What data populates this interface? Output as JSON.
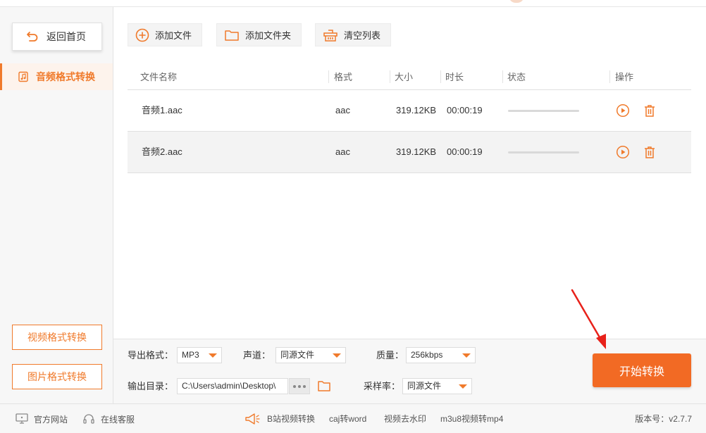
{
  "sidebar": {
    "back_label": "返回首页",
    "active_item": "音频格式转换",
    "video_convert": "视频格式转换",
    "image_convert": "图片格式转换"
  },
  "toolbar": {
    "add_file": "添加文件",
    "add_folder": "添加文件夹",
    "clear_list": "清空列表"
  },
  "table": {
    "columns": [
      "文件名称",
      "格式",
      "大小",
      "时长",
      "状态",
      "操作"
    ],
    "rows": [
      {
        "name": "音频1.aac",
        "format": "aac",
        "size": "319.12KB",
        "duration": "00:00:19",
        "progress": 0
      },
      {
        "name": "音频2.aac",
        "format": "aac",
        "size": "319.12KB",
        "duration": "00:00:19",
        "progress": 0
      }
    ]
  },
  "settings": {
    "export_format_label": "导出格式：",
    "export_format_value": "MP3",
    "channel_label": "声道：",
    "channel_value": "同源文件",
    "quality_label": "质量：",
    "quality_value": "256kbps",
    "output_dir_label": "输出目录：",
    "output_dir_value": "C:\\Users\\admin\\Desktop\\",
    "sample_rate_label": "采样率：",
    "sample_rate_value": "同源文件"
  },
  "start_button": "开始转换",
  "footer": {
    "website": "官方网站",
    "support": "在线客服",
    "links": [
      "B站视频转换",
      "caj转word",
      "视频去水印",
      "m3u8视频转mp4"
    ],
    "version": "版本号：v2.7.7"
  },
  "colors": {
    "accent": "#f07a2b",
    "start_button": "#f26a24"
  },
  "icons": [
    "undo-arrow-icon",
    "music-file-icon",
    "plus-circle-icon",
    "folder-icon",
    "basket-icon",
    "play-icon",
    "trash-icon",
    "monitor-icon",
    "headset-icon",
    "megaphone-icon"
  ]
}
